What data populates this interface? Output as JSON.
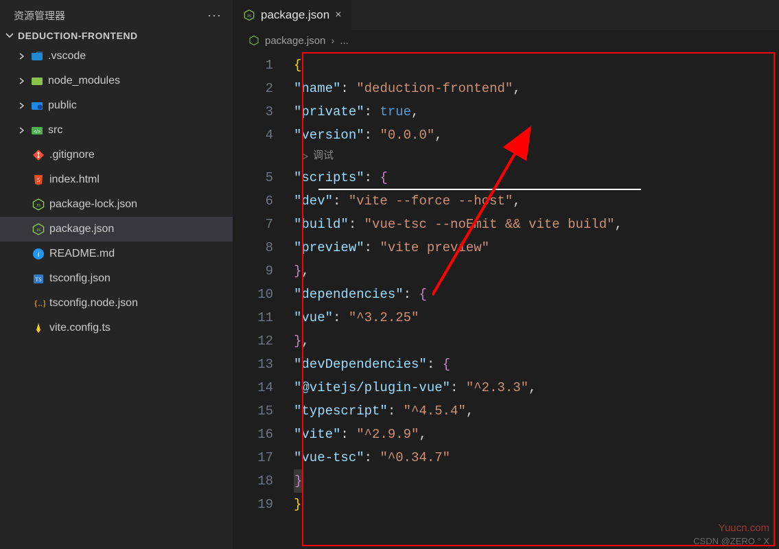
{
  "sidebar": {
    "title": "资源管理器",
    "project": "DEDUCTION-FRONTEND",
    "items": [
      {
        "label": ".vscode",
        "chev": true,
        "icon": "folder-vscode"
      },
      {
        "label": "node_modules",
        "chev": true,
        "icon": "folder-node"
      },
      {
        "label": "public",
        "chev": true,
        "icon": "folder-public"
      },
      {
        "label": "src",
        "chev": true,
        "icon": "folder-src"
      },
      {
        "label": ".gitignore",
        "chev": false,
        "icon": "git"
      },
      {
        "label": "index.html",
        "chev": false,
        "icon": "html"
      },
      {
        "label": "package-lock.json",
        "chev": false,
        "icon": "njs"
      },
      {
        "label": "package.json",
        "chev": false,
        "icon": "njs",
        "selected": true
      },
      {
        "label": "README.md",
        "chev": false,
        "icon": "info"
      },
      {
        "label": "tsconfig.json",
        "chev": false,
        "icon": "ts"
      },
      {
        "label": "tsconfig.node.json",
        "chev": false,
        "icon": "tsnode"
      },
      {
        "label": "vite.config.ts",
        "chev": false,
        "icon": "vite"
      }
    ]
  },
  "tab": {
    "label": "package.json"
  },
  "breadcrumb": {
    "file": "package.json",
    "tail": "..."
  },
  "debug_label": "调试",
  "code": {
    "line_numbers": [
      "1",
      "2",
      "3",
      "4",
      "5",
      "6",
      "7",
      "8",
      "9",
      "10",
      "11",
      "12",
      "13",
      "14",
      "15",
      "16",
      "17",
      "18",
      "19"
    ],
    "json": {
      "name": "deduction-frontend",
      "private": true,
      "version": "0.0.0",
      "scripts": {
        "dev": "vite --force --host",
        "build": "vue-tsc --noEmit && vite build",
        "preview": "vite preview"
      },
      "dependencies": {
        "vue": "^3.2.25"
      },
      "devDependencies": {
        "@vitejs/plugin-vue": "^2.3.3",
        "typescript": "^4.5.4",
        "vite": "^2.9.9",
        "vue-tsc": "^0.34.7"
      }
    }
  },
  "watermarks": {
    "w1": "Yuucn.com",
    "w2": "CSDN @ZERO ° X"
  }
}
